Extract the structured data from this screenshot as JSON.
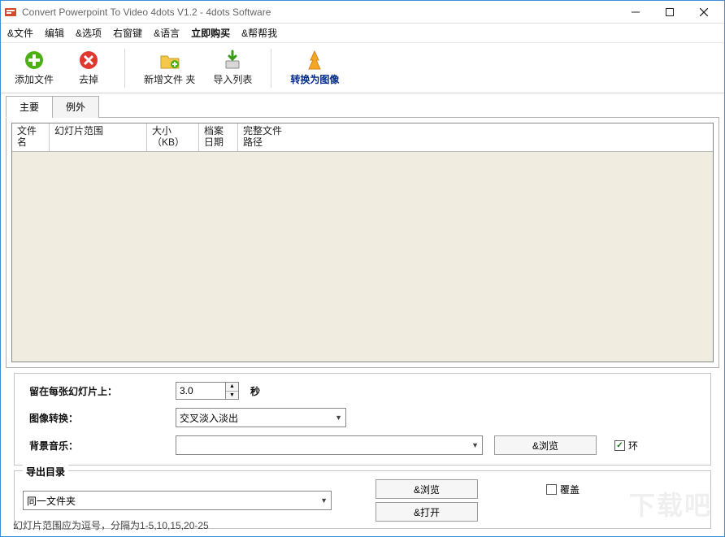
{
  "window": {
    "title": "Convert Powerpoint To Video 4dots V1.2 - 4dots Software"
  },
  "menu": {
    "file": "&文件",
    "edit": "编辑",
    "options": "&选项",
    "hotkeys": "右窗键",
    "language": "&语言",
    "buy": "立即购买",
    "help": "&帮帮我"
  },
  "toolbar": {
    "add_files": "添加文件",
    "remove": "去掉",
    "new_folder": "新增文件 夹",
    "import_list": "导入列表",
    "convert_image": "转换为图像"
  },
  "tabs": {
    "main": "主要",
    "except": "例外"
  },
  "grid_headers": {
    "filename": "文件名",
    "slide_range": "幻灯片范围",
    "size": "大小（KB）",
    "archive_date": "档案日期",
    "full_path": "完整文件路径"
  },
  "settings": {
    "stay_label": "留在每张幻灯片上：",
    "stay_value": "3.0",
    "stay_unit": "秒",
    "transition_label": "图像转换：",
    "transition_value": "交叉淡入淡出",
    "bgm_label": "背景音乐：",
    "bgm_value": "",
    "browse": "&浏览",
    "loop": "环"
  },
  "output": {
    "legend": "导出目录",
    "same_folder": "同一文件夹",
    "browse": "&浏览",
    "open": "&打开",
    "overwrite": "覆盖"
  },
  "status": {
    "hint": "幻灯片范围应为逗号，分隔为1-5,10,15,20-25"
  },
  "watermark": "下载吧"
}
